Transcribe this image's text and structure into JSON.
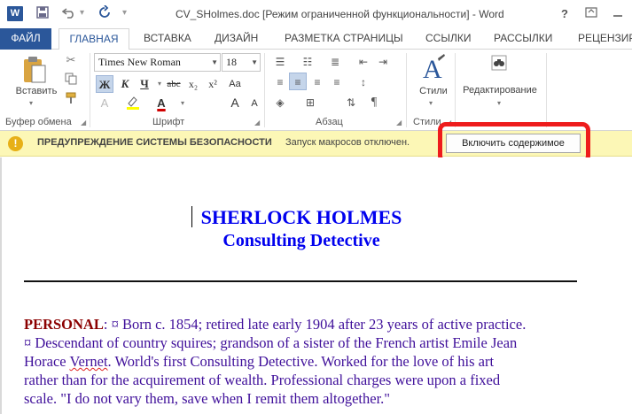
{
  "window": {
    "title": "CV_SHolmes.doc [Режим ограниченной функциональности] - Word",
    "logo": "W",
    "help": "?",
    "icons": [
      "word-logo-icon",
      "save-icon",
      "undo-icon",
      "redo-icon",
      "customize-qat-icon",
      "ribbon-options-icon",
      "minimize-icon"
    ]
  },
  "tabs": {
    "file": "ФАЙЛ",
    "home": "ГЛАВНАЯ",
    "insert": "ВСТАВКА",
    "design": "ДИЗАЙН",
    "layout": "РАЗМЕТКА СТРАНИЦЫ",
    "references": "ССЫЛКИ",
    "mailings": "РАССЫЛКИ",
    "review": "РЕЦЕНЗИРО"
  },
  "ribbon": {
    "clipboard": {
      "paste_label": "Вставить",
      "group_label": "Буфер обмена"
    },
    "font": {
      "name": "Times New Roman",
      "size": "18",
      "bold": "Ж",
      "italic": "К",
      "underline": "Ч",
      "strike": "abc",
      "subscript": "x₂",
      "superscript": "x²",
      "grow": "A",
      "shrink": "A",
      "case": "Aa",
      "group_label": "Шрифт"
    },
    "paragraph": {
      "group_label": "Абзац",
      "show_marks": "¶"
    },
    "styles": {
      "label": "Стили",
      "group_label": "Стили"
    },
    "editing": {
      "label": "Редактирование"
    }
  },
  "security_bar": {
    "title": "ПРЕДУПРЕЖДЕНИЕ СИСТЕМЫ БЕЗОПАСНОСТИ",
    "message": "Запуск макросов отключен.",
    "button": "Включить содержимое",
    "icon": "!"
  },
  "document": {
    "heading1": "SHERLOCK HOLMES",
    "heading2": "Consulting Detective",
    "personal_label": "PERSONAL",
    "line1": ": ¤ Born c. 1854; retired late early 1904 after 23 years of active practice.",
    "line2": "¤ Descendant of country squires; grandson of a sister of the French artist Emile Jean",
    "line3_pre": "Horace ",
    "line3_squiggle": "Vernet",
    "line3_post": ". World's first Consulting Detective. Worked for the love of his art",
    "line4": "rather than for the acquirement of wealth. Professional charges were upon a fixed",
    "line5": "scale. \"I do not vary them, save when I remit them altogether.\""
  },
  "colors": {
    "accent": "#2b579a",
    "security_bar": "#fcf7b6",
    "highlight": "#ee1c1c",
    "heading": "#0000ee",
    "body_text": "#3f0f9a",
    "label": "#8b0000"
  }
}
